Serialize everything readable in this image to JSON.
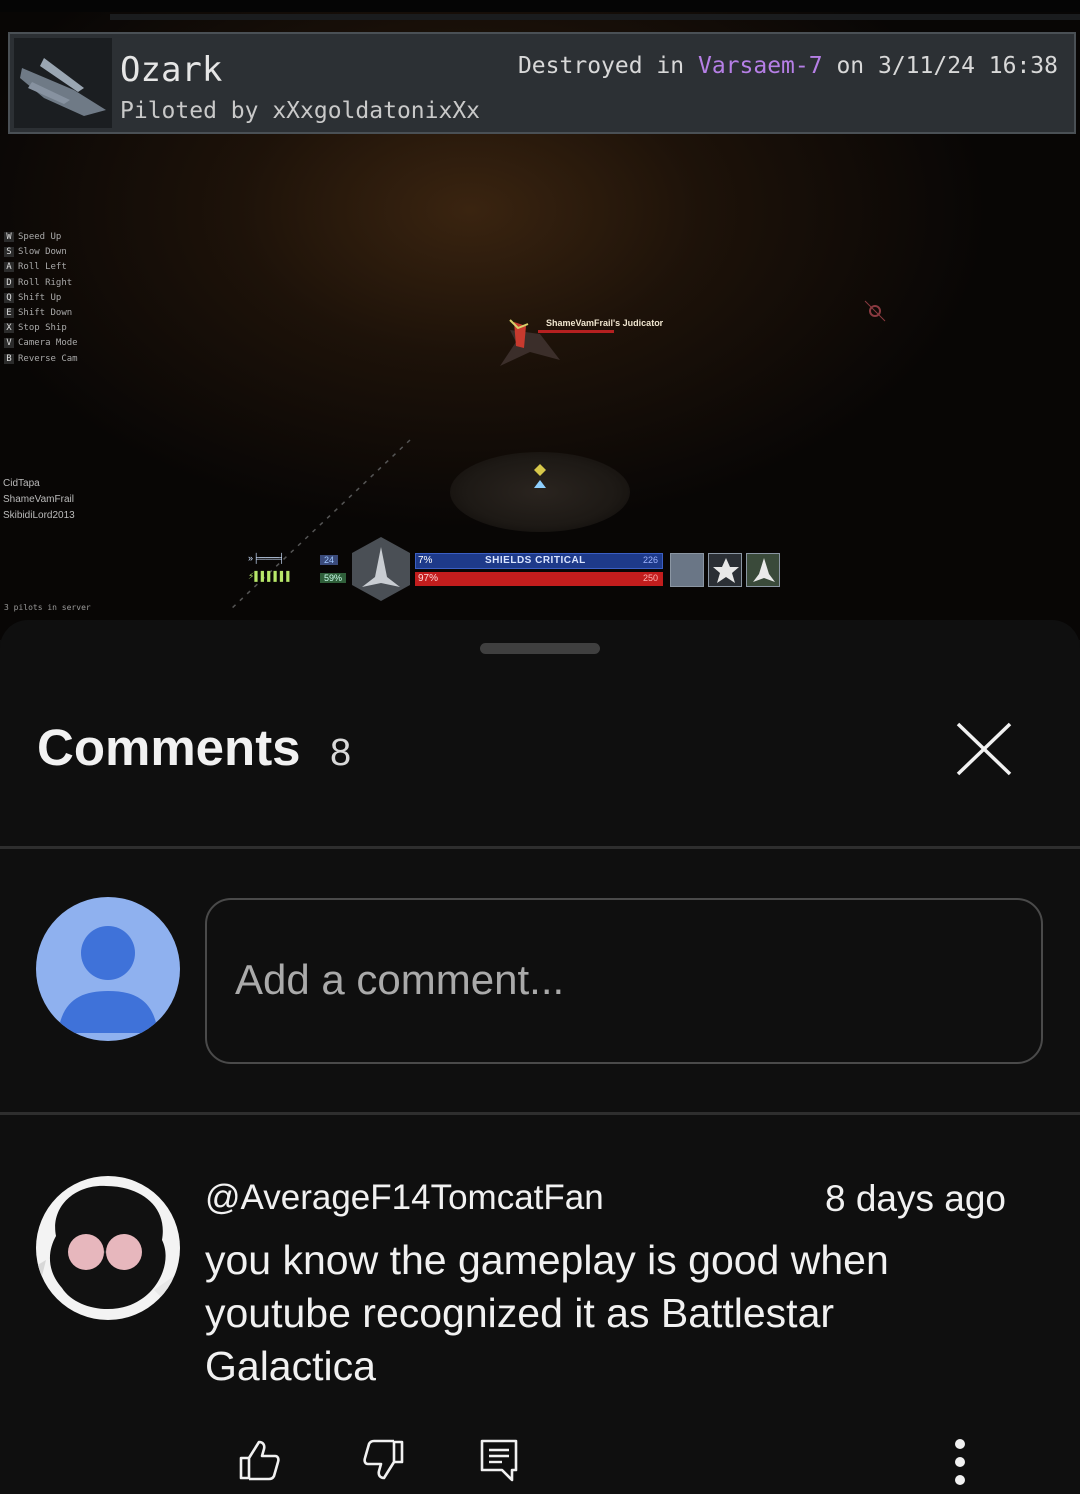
{
  "video": {
    "killcard": {
      "ship_name": "Ozark",
      "piloted_by": "Piloted by xXxgoldatonixXx",
      "destroyed_prefix": "Destroyed in ",
      "location": "Varsaem-7",
      "destroyed_suffix": " on 3/11/24 16:38"
    },
    "keybinds": [
      {
        "key": "W",
        "action": "Speed Up"
      },
      {
        "key": "S",
        "action": "Slow Down"
      },
      {
        "key": "A",
        "action": "Roll Left"
      },
      {
        "key": "D",
        "action": "Roll Right"
      },
      {
        "key": "Q",
        "action": "Shift Up"
      },
      {
        "key": "E",
        "action": "Shift Down"
      },
      {
        "key": "X",
        "action": "Stop Ship"
      },
      {
        "key": "V",
        "action": "Camera Mode"
      },
      {
        "key": "B",
        "action": "Reverse Cam"
      }
    ],
    "players": [
      "CidTapa",
      "ShameVamFrail",
      "SkibidiLord2013"
    ],
    "pilots_in_server": "3 pilots in server",
    "target_label": "ShameVamFrail's Judicator",
    "hud": {
      "shield_pct": "7%",
      "shield_text": "SHIELDS CRITICAL",
      "shield_value": "226",
      "hull_pct": "97%",
      "hull_value": "250",
      "speed": "24",
      "throttle": "59%"
    },
    "colors": {
      "location": "#b67fe6",
      "shield": "#1e3a8a",
      "hull": "#c21d1d"
    }
  },
  "comments_panel": {
    "title": "Comments",
    "count": "8",
    "close_icon": "close-icon",
    "input_placeholder": "Add a comment...",
    "comments": [
      {
        "author": "@AverageF14TomcatFan",
        "time": "8 days ago",
        "text": "you know the gameplay is good when youtube recognized it as Battlestar Galactica"
      }
    ]
  }
}
